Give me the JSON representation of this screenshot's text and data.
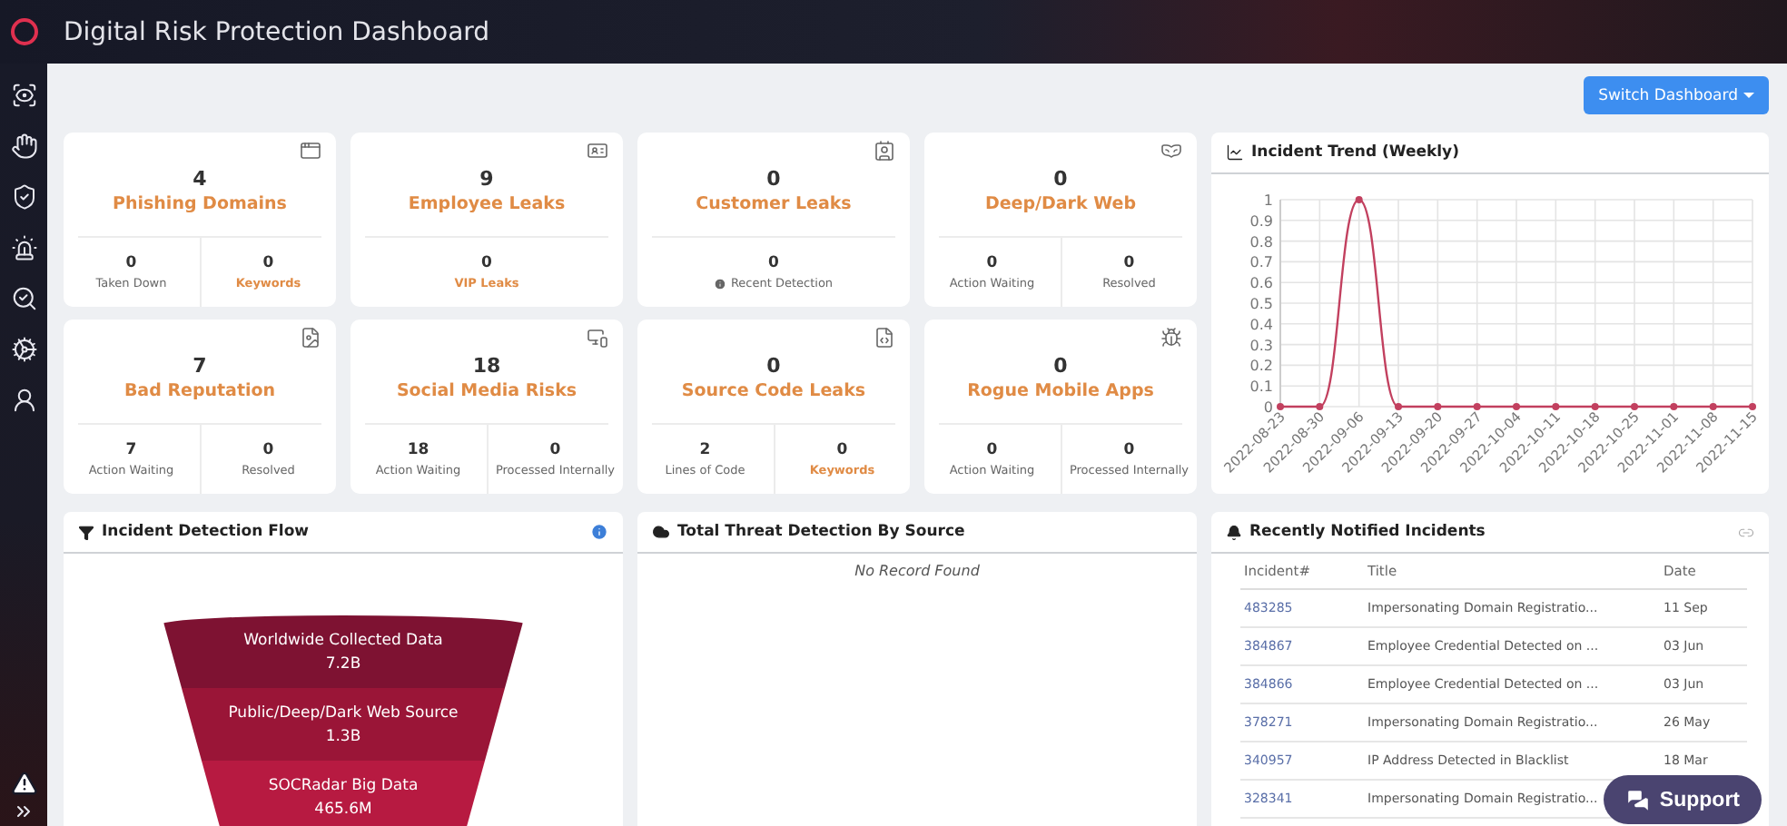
{
  "header": {
    "title": "Digital Risk Protection Dashboard"
  },
  "switch_button": {
    "label": "Switch Dashboard"
  },
  "cards": [
    {
      "count": "4",
      "title": "Phishing Domains",
      "stats": [
        {
          "value": "0",
          "label": "Taken Down",
          "kind": "plain"
        },
        {
          "value": "0",
          "label": "Keywords",
          "kind": "link"
        }
      ]
    },
    {
      "count": "9",
      "title": "Employee Leaks",
      "stats": [
        {
          "value": "0",
          "label": "VIP Leaks",
          "kind": "link"
        }
      ]
    },
    {
      "count": "0",
      "title": "Customer Leaks",
      "stats": [
        {
          "value": "0",
          "label": "Recent Detection",
          "kind": "info"
        }
      ]
    },
    {
      "count": "0",
      "title": "Deep/Dark Web",
      "stats": [
        {
          "value": "0",
          "label": "Action Waiting",
          "kind": "plain"
        },
        {
          "value": "0",
          "label": "Resolved",
          "kind": "plain"
        }
      ]
    },
    {
      "count": "7",
      "title": "Bad Reputation",
      "stats": [
        {
          "value": "7",
          "label": "Action Waiting",
          "kind": "plain"
        },
        {
          "value": "0",
          "label": "Resolved",
          "kind": "plain"
        }
      ]
    },
    {
      "count": "18",
      "title": "Social Media Risks",
      "stats": [
        {
          "value": "18",
          "label": "Action Waiting",
          "kind": "plain"
        },
        {
          "value": "0",
          "label": "Processed Internally",
          "kind": "plain"
        }
      ]
    },
    {
      "count": "0",
      "title": "Source Code Leaks",
      "stats": [
        {
          "value": "2",
          "label": "Lines of Code",
          "kind": "plain"
        },
        {
          "value": "0",
          "label": "Keywords",
          "kind": "link"
        }
      ]
    },
    {
      "count": "0",
      "title": "Rogue Mobile Apps",
      "stats": [
        {
          "value": "0",
          "label": "Action Waiting",
          "kind": "plain"
        },
        {
          "value": "0",
          "label": "Processed Internally",
          "kind": "plain"
        }
      ]
    }
  ],
  "trend": {
    "title": "Incident Trend (Weekly)",
    "chart_data": {
      "type": "line",
      "categories": [
        "2022-08-23",
        "2022-08-30",
        "2022-09-06",
        "2022-09-13",
        "2022-09-20",
        "2022-09-27",
        "2022-10-04",
        "2022-10-11",
        "2022-10-18",
        "2022-10-25",
        "2022-11-01",
        "2022-11-08",
        "2022-11-15"
      ],
      "grid": true,
      "series": [
        {
          "color": "#c2405f",
          "marker": true,
          "values": [
            0,
            0,
            1,
            0,
            0,
            0,
            0,
            0,
            0,
            0,
            0,
            0,
            0
          ]
        }
      ],
      "ylim": [
        0,
        1
      ],
      "yticks": [
        0,
        0.1,
        0.2,
        0.3,
        0.4,
        0.5,
        0.6,
        0.7,
        0.8,
        0.9,
        1
      ]
    }
  },
  "flow": {
    "title": "Incident Detection Flow",
    "stages": [
      {
        "label": "Worldwide Collected Data",
        "value": "7.2B"
      },
      {
        "label": "Public/Deep/Dark Web Source",
        "value": "1.3B"
      },
      {
        "label": "SOCRadar Big Data",
        "value": "465.6M"
      }
    ]
  },
  "sources": {
    "title": "Total Threat Detection By Source",
    "empty_text": "No Record Found"
  },
  "incidents": {
    "title": "Recently Notified Incidents",
    "columns": [
      "Incident#",
      "Title",
      "Date"
    ],
    "rows": [
      {
        "id": "483285",
        "title": "Impersonating Domain Registratio...",
        "date": "11 Sep"
      },
      {
        "id": "384867",
        "title": "Employee Credential Detected on ...",
        "date": "03 Jun"
      },
      {
        "id": "384866",
        "title": "Employee Credential Detected on ...",
        "date": "03 Jun"
      },
      {
        "id": "378271",
        "title": "Impersonating Domain Registratio...",
        "date": "26 May"
      },
      {
        "id": "340957",
        "title": "IP Address Detected in Blacklist",
        "date": "18 Mar"
      },
      {
        "id": "328341",
        "title": "Impersonating Domain Registratio..."
      }
    ]
  },
  "support": {
    "label": "Support"
  }
}
